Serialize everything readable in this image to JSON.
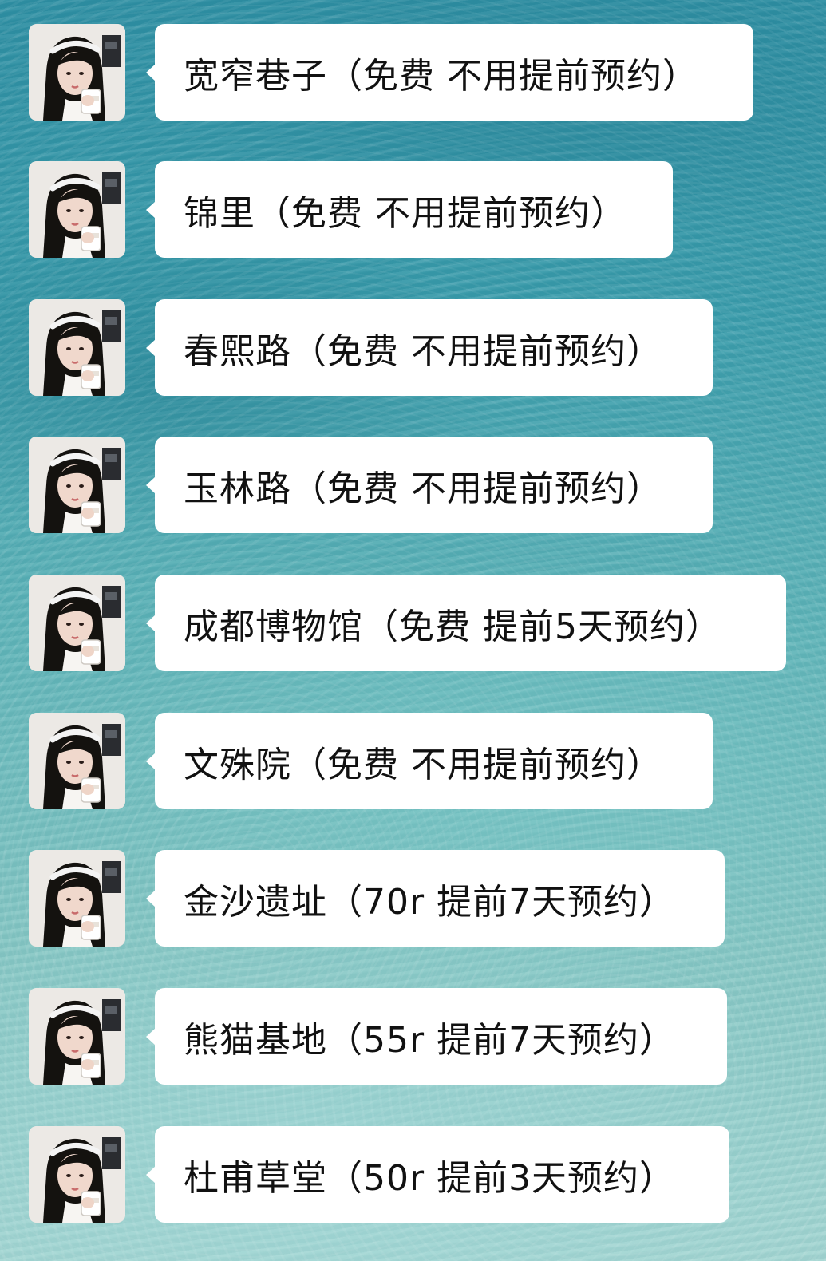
{
  "messages": [
    {
      "text": "宽窄巷子（免费 不用提前预约）"
    },
    {
      "text": "锦里（免费 不用提前预约）"
    },
    {
      "text": "春熙路（免费 不用提前预约）"
    },
    {
      "text": "玉林路（免费 不用提前预约）"
    },
    {
      "text": "成都博物馆（免费 提前5天预约）"
    },
    {
      "text": "文殊院（免费 不用提前预约）"
    },
    {
      "text": "金沙遗址（70r 提前7天预约）"
    },
    {
      "text": "熊猫基地（55r 提前7天预约）"
    },
    {
      "text": "杜甫草堂（50r 提前3天预约）"
    }
  ],
  "colors": {
    "bubble": "#ffffff",
    "text": "#111111",
    "water": "#3a9cab"
  }
}
